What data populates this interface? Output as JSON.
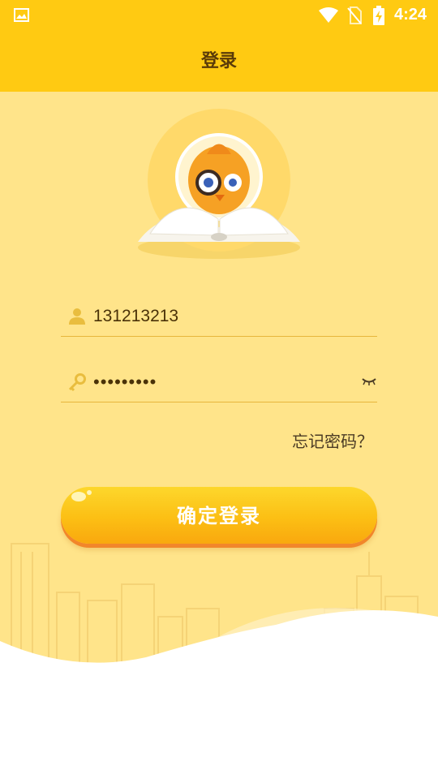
{
  "status_bar": {
    "time": "4:24",
    "icons": [
      "gallery-icon",
      "wifi-icon",
      "no-sim-icon",
      "battery-charging-icon"
    ]
  },
  "header": {
    "title": "登录"
  },
  "login_form": {
    "username": {
      "value": "131213213",
      "icon": "user-icon"
    },
    "password": {
      "value": "•••••••••",
      "icon": "key-icon",
      "toggle_icon": "eye-closed-icon"
    },
    "forgot_label": "忘记密码？",
    "submit_label": "确定登录"
  },
  "colors": {
    "header_bg": "#ffca12",
    "page_bg": "#ffe48a",
    "button_gradient_top": "#fdd72c",
    "button_gradient_bottom": "#f9a80e",
    "field_underline": "#e6b63b"
  }
}
